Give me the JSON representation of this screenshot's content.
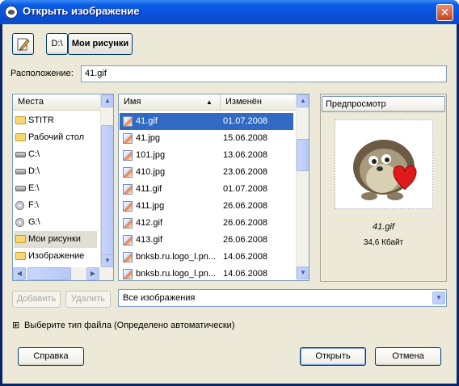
{
  "window": {
    "title": "Открыть изображение",
    "close": "✕"
  },
  "toolbar": {
    "path_buttons": [
      "D:\\",
      "Мои рисунки"
    ]
  },
  "location": {
    "label": "Расположение:",
    "value": "41.gif"
  },
  "places": {
    "header": "Места",
    "items": [
      {
        "label": "STITR",
        "icon": "folder-icon"
      },
      {
        "label": "Рабочий стол",
        "icon": "folder-icon"
      },
      {
        "label": "C:\\",
        "icon": "drive-icon"
      },
      {
        "label": "D:\\",
        "icon": "drive-icon"
      },
      {
        "label": "E:\\",
        "icon": "drive-icon"
      },
      {
        "label": "F:\\",
        "icon": "cdrom-icon"
      },
      {
        "label": "G:\\",
        "icon": "cdrom-icon"
      },
      {
        "label": "Мои рисунки",
        "icon": "pictures-folder-icon"
      },
      {
        "label": "Изображение",
        "icon": "folder-icon"
      }
    ],
    "add_button": "Добавить",
    "remove_button": "Удалить"
  },
  "files": {
    "col_name": "Имя",
    "col_modified": "Изменён",
    "rows": [
      {
        "name": "41.gif",
        "date": "01.07.2008"
      },
      {
        "name": "41.jpg",
        "date": "15.06.2008"
      },
      {
        "name": "101.jpg",
        "date": "13.06.2008"
      },
      {
        "name": "410.jpg",
        "date": "23.06.2008"
      },
      {
        "name": "411.gif",
        "date": "01.07.2008"
      },
      {
        "name": "411.jpg",
        "date": "26.06.2008"
      },
      {
        "name": "412.gif",
        "date": "26.06.2008"
      },
      {
        "name": "413.gif",
        "date": "26.06.2008"
      },
      {
        "name": "bnksb.ru.logo_l.pn...",
        "date": "14.06.2008"
      },
      {
        "name": "bnksb.ru.logo_l.pn...",
        "date": "14.06.2008"
      }
    ],
    "selected_index": 0,
    "filter": "Все изображения"
  },
  "preview": {
    "header": "Предпросмотр",
    "filename": "41.gif",
    "size": "34,6 Кбайт"
  },
  "filetype": {
    "expander": "⊞",
    "label": "Выберите тип файла (Определено автоматически)"
  },
  "buttons": {
    "help": "Справка",
    "open": "Открыть",
    "cancel": "Отмена"
  },
  "colors": {
    "selection": "#316ac5",
    "titlebar": "#0a4fd8",
    "dialog_bg": "#ece9d8"
  }
}
